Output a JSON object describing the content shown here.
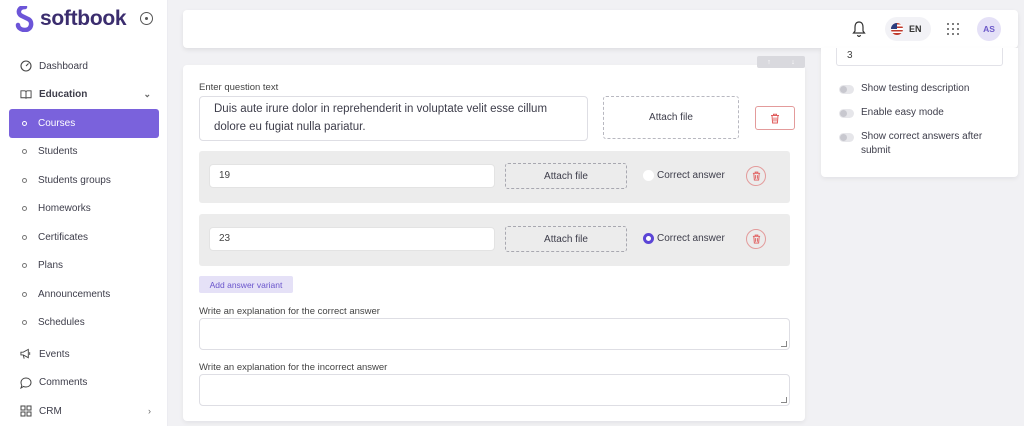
{
  "brand": {
    "name": "softbook"
  },
  "sidebar": {
    "items": [
      {
        "label": "Dashboard"
      },
      {
        "label": "Education"
      },
      {
        "label": "Courses"
      },
      {
        "label": "Students"
      },
      {
        "label": "Students groups"
      },
      {
        "label": "Homeworks"
      },
      {
        "label": "Certificates"
      },
      {
        "label": "Plans"
      },
      {
        "label": "Announcements"
      },
      {
        "label": "Schedules"
      },
      {
        "label": "Events"
      },
      {
        "label": "Comments"
      },
      {
        "label": "CRM"
      }
    ]
  },
  "topbar": {
    "language": "EN",
    "avatar_initials": "AS"
  },
  "settings": {
    "number_value": "3",
    "toggles": [
      {
        "label": "Show testing description"
      },
      {
        "label": "Enable easy mode"
      },
      {
        "label": "Show correct answers after submit"
      }
    ]
  },
  "question": {
    "label": "Enter question text",
    "text": "Duis aute irure dolor in reprehenderit in voluptate velit esse cillum dolore eu fugiat nulla pariatur.",
    "attach_label": "Attach file",
    "sort_up": "↑",
    "sort_down": "↓"
  },
  "answers": [
    {
      "value": "19",
      "attach_label": "Attach file",
      "correct_label": "Correct answer",
      "is_correct": false
    },
    {
      "value": "23",
      "attach_label": "Attach file",
      "correct_label": "Correct answer",
      "is_correct": true
    }
  ],
  "add_variant_label": "Add answer variant",
  "explanations": {
    "correct_label": "Write an explanation for the correct answer",
    "incorrect_label": "Write an explanation for the incorrect answer"
  },
  "colors": {
    "accent": "#7a62dc",
    "danger": "#e05c5c",
    "brand_text": "#3b2d6e"
  }
}
